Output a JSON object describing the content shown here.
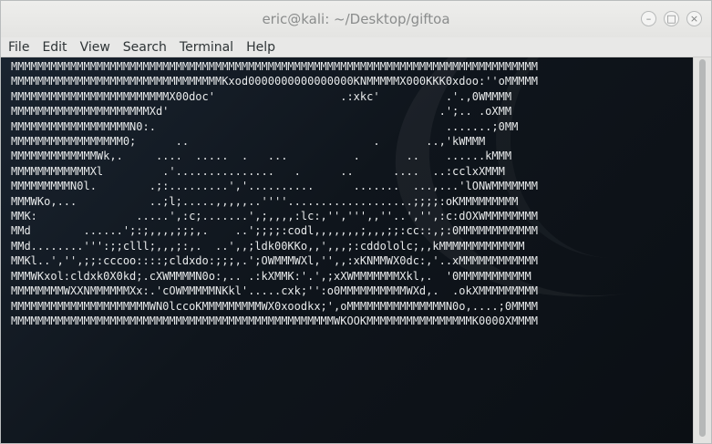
{
  "window": {
    "title": "eric@kali: ~/Desktop/giftoa",
    "minimize_glyph": "–",
    "maximize_glyph": "□",
    "close_glyph": "×"
  },
  "menubar": {
    "items": [
      "File",
      "Edit",
      "View",
      "Search",
      "Terminal",
      "Help"
    ]
  },
  "terminal": {
    "lines": [
      "MMMMMMMMMMMMMMMMMMMMMMMMMMMMMMMMMMMMMMMMMMMMMMMMMMMMMMMMMMMMMMMMMMMMMMMMMMMMMMMMMMMMMMMMMMMMM",
      "MMMMMMMMMMMMMMMMMMMMMMMMMMMMMMMMKxod0000000000000000KNMMMMMX000KKK0xdoo:''oMMMMM",
      "MMMMMMMMMMMMMMMMMMMMMMMMX00doc'                   .:xkc'          .'.,0WMMMM",
      "MMMMMMMMMMMMMMMMMMMMMXd'                                         .';.. .oXMM",
      "MMMMMMMMMMMMMMMMMMN0:.                                            .......;0MM",
      "MMMMMMMMMMMMMMMMM0;      ..                            .       ..,'kWMMM",
      "MMMMMMMMMMMMMWk,.     ....  .....  .   ...          .       ..    ......kMMM",
      "MMMMMMMMMMMMXl         .'...............   .      ..      ....  ..:cclxXMMM",
      "MMMMMMMMMN0l.        .;:.........','..........      .......  ...,...'lONWMMMMMMM",
      "MMMWKo,...           ..;l;.....,,,,,..''''...................;;;;:oKMMMMMMMMM",
      "MMK:               .....',:c;.......',;,,,,:lc:,'',''',,''..','',:c:dOXWMMMMMMMMMM",
      "MMd        ......';:;,,,,;;;,.    ..';;;;:codl,,,,,,,;,,,;;:cc::,;:0MMMMMMMMMMMMM",
      "MMd........''':;;clll;,,,;:,.  ..',,;ldk00KKo,,',,,;:cddololc;,,kMMMMMMMMMMMMM",
      "MMKl..','',;;:cccoo::::;cldxdo:;;;,.';OWMMMWXl,'',,:xKNMMWX0dc:,'..xMMMMMMMMMMMM",
      "MMMWKxol:cldxk0X0kd;.cXWMMMMN0o:,.. .:kXMMK:'.',;xXWMMMMMMMXkl,.  '0MMMMMMMMMMM",
      "MMMMMMMMWXXNMMMMMMXx:.'cOWMMMMMNKkl'.....cxk;'':o0MMMMMMMMMMWXd,.  .okXMMMMMMMMM",
      "MMMMMMMMMMMMMMMMMMMMMWN0lccoKMMMMMMMMMWX0xoodkx;',oMMMMMMMMMMMMMMMN0o,....;0MMMMMMMMM",
      "MMMMMMMMMMMMMMMMMMMMMMMMMMMMMMMMMMMMMMMMMMMMMMMMMWKOOKMMMMMMMMMMMMMMMMK0000XMMMMMMMMMM"
    ]
  },
  "colors": {
    "terminal_text": "#e8eaeb",
    "terminal_bg": "#121a22",
    "titlebar_bg": "#eaeae8"
  }
}
